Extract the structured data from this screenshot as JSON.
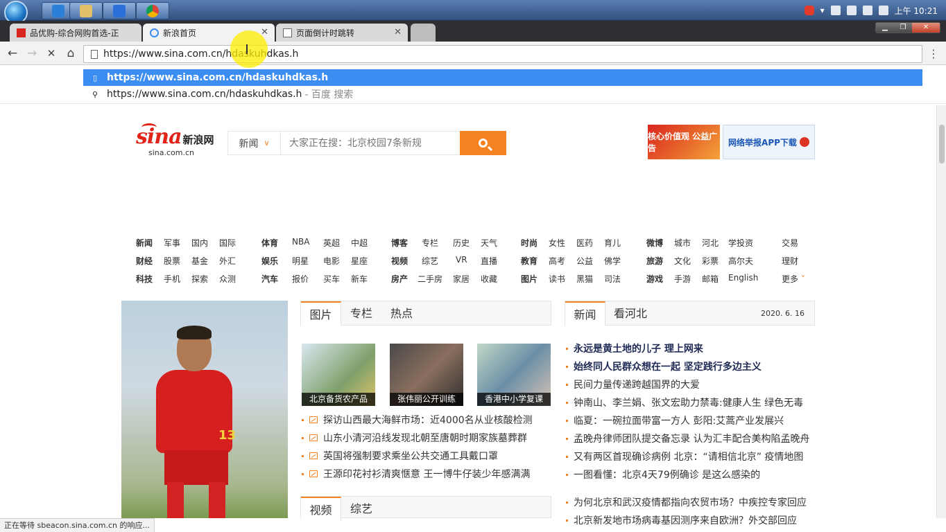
{
  "taskbar": {
    "apps": [
      {
        "name": "vscode",
        "color": "#2c7fd6"
      },
      {
        "name": "file-explorer",
        "color": "#e3c067"
      },
      {
        "name": "shield-app",
        "color": "#2b6fdb"
      },
      {
        "name": "chrome",
        "color": "#db4437"
      }
    ],
    "tray_time": "上午 10:21"
  },
  "tabs": [
    {
      "title": "品优购-综合网购首选-正",
      "state": "inactive"
    },
    {
      "title": "新浪首页",
      "state": "active"
    },
    {
      "title": "页面倒计时跳转",
      "state": "inactive"
    }
  ],
  "omnibox": {
    "value": "https://www.sina.com.cn/hdaskuhdkas.h"
  },
  "suggestions": {
    "selected": "https://www.sina.com.cn/hdaskuhdkas.h",
    "search_text": "https://www.sina.com.cn/hdaskuhdkas.h",
    "search_suffix": "- 百度 搜索"
  },
  "logo": {
    "brand": "sina",
    "name": "新浪网",
    "domain": "sina.com.cn"
  },
  "search": {
    "category": "新闻",
    "placeholder": "大家正在搜：北京校园7条新规"
  },
  "ads": {
    "left": "核心价值观 公益广告",
    "right": "网络举报APP下载"
  },
  "nav": {
    "col1": [
      [
        "新闻",
        "军事",
        "国内",
        "国际"
      ],
      [
        "财经",
        "股票",
        "基金",
        "外汇"
      ],
      [
        "科技",
        "手机",
        "探索",
        "众测"
      ]
    ],
    "col2": [
      [
        "体育",
        "NBA",
        "英超",
        "中超"
      ],
      [
        "娱乐",
        "明星",
        "电影",
        "星座"
      ],
      [
        "汽车",
        "报价",
        "买车",
        "新车"
      ]
    ],
    "col3": [
      [
        "博客",
        "专栏",
        "历史",
        "天气"
      ],
      [
        "视频",
        "综艺",
        "VR",
        "直播"
      ],
      [
        "房产",
        "二手房",
        "家居",
        "收藏"
      ]
    ],
    "col4": [
      [
        "时尚",
        "女性",
        "医药",
        "育儿"
      ],
      [
        "教育",
        "高考",
        "公益",
        "佛学"
      ],
      [
        "图片",
        "读书",
        "黑猫",
        "司法"
      ]
    ],
    "col5": [
      [
        "微博",
        "城市",
        "河北",
        "学投资"
      ],
      [
        "旅游",
        "文化",
        "彩票",
        "高尔夫"
      ],
      [
        "游戏",
        "手游",
        "邮箱",
        "English"
      ]
    ],
    "col6": [
      "交易",
      "理财",
      "更多"
    ]
  },
  "hero": {
    "number": "13"
  },
  "mid": {
    "tabs": [
      "图片",
      "专栏",
      "热点"
    ],
    "thumbs": [
      "北京备货农产品",
      "张伟丽公开训练",
      "香港中小学复课"
    ],
    "items": [
      "探访山西最大海鲜市场：近4000名从业核酸检测",
      "山东小清河沿线发现北朝至唐朝时期家族墓葬群",
      "英国将强制要求乘坐公共交通工具戴口罩",
      "王源印花衬衫清爽惬意 王一博牛仔装少年感满满"
    ],
    "tabs2": [
      "视频",
      "综艺"
    ]
  },
  "right": {
    "tabs": [
      "新闻",
      "看河北"
    ],
    "date": "2020. 6. 16",
    "items": [
      {
        "text": "永远是黄土地的儿子 理上网来",
        "strong": true
      },
      {
        "text": "始终同人民群众想在一起 坚定践行多边主义",
        "strong": true
      },
      {
        "text": "民间力量传递跨越国界的大爱",
        "strong": false
      },
      {
        "text": "钟南山、李兰娟、张文宏助力禁毒:健康人生  绿色无毒",
        "strong": false
      },
      {
        "text": "临夏：一碗拉面带富一方人  彭阳:艾蒿产业发展兴",
        "strong": false
      },
      {
        "text": "孟晚舟律师团队提交备忘录  认为汇丰配合美构陷孟晚舟",
        "strong": false
      },
      {
        "text": "又有两区首现确诊病例  北京：“请相信北京”  疫情地图",
        "strong": false
      },
      {
        "text": "一图看懂：北京4天79例确诊  是这么感染的",
        "strong": false
      },
      {
        "text": "为何北京和武汉疫情都指向农贸市场？中疾控专家回应",
        "strong": false
      },
      {
        "text": "北京新发地市场病毒基因测序来自欧洲？外交部回应",
        "strong": false
      }
    ]
  },
  "status": "正在等待 sbeacon.sina.com.cn 的响应..."
}
